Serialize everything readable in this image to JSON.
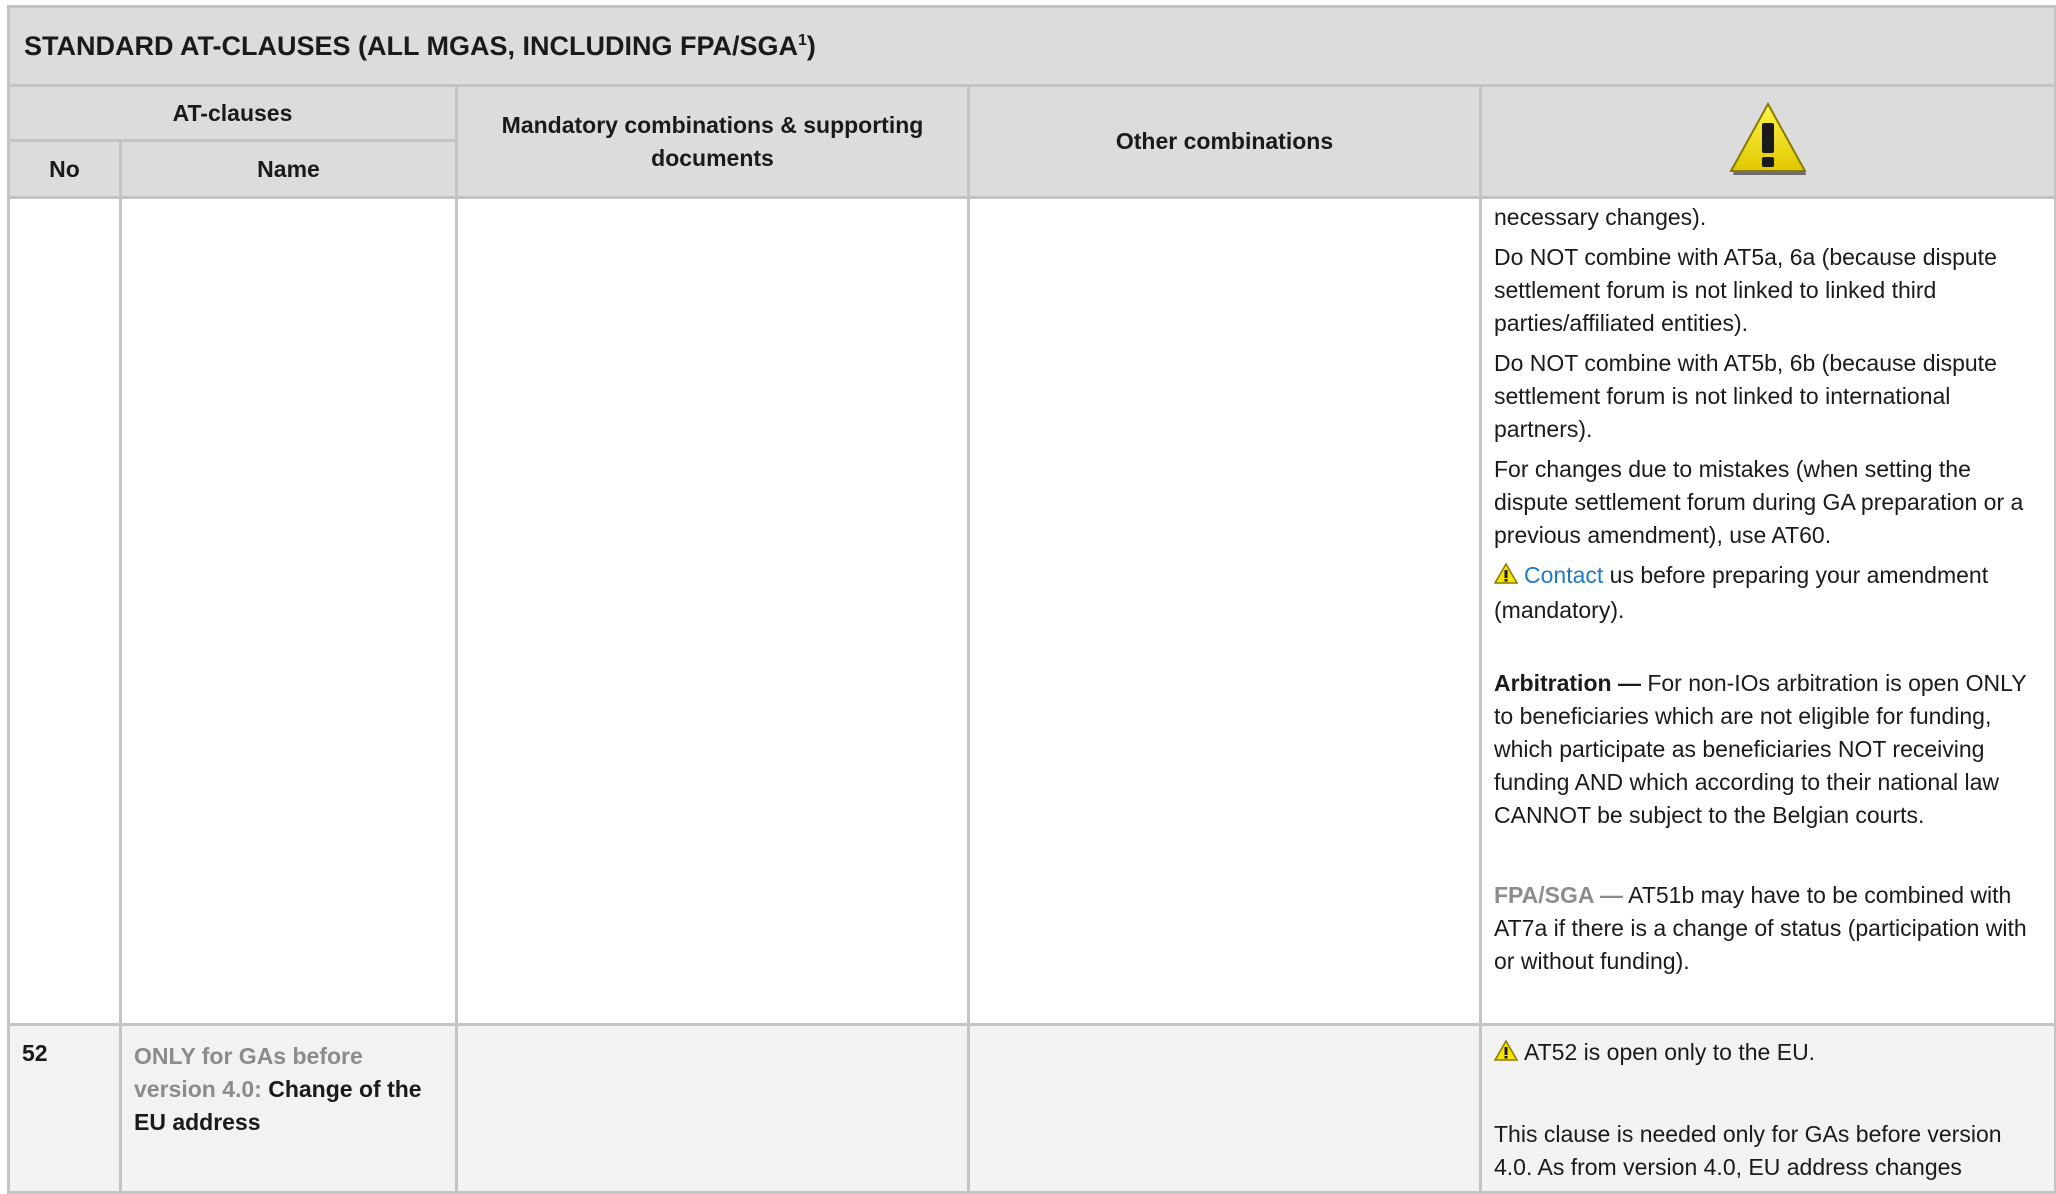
{
  "table": {
    "title": "STANDARD AT-CLAUSES (ALL MGAS, INCLUDING FPA/SGA",
    "title_sup": "1",
    "title_close": ")",
    "headers": {
      "at_clauses": "AT-clauses",
      "no": "No",
      "name": "Name",
      "mandatory": "Mandatory combinations & supporting documents",
      "other": "Other combinations"
    },
    "warning_icon": "warning-triangle-icon"
  },
  "row1": {
    "notes": {
      "p1": "necessary changes).",
      "p2": "Do NOT combine with AT5a, 6a (because dispute settlement forum is not linked to linked third parties/affiliated entities).",
      "p3": "Do NOT combine with AT5b, 6b (because dispute settlement forum is not linked to international partners).",
      "p4": "For changes due to mistakes (when setting the dispute settlement forum during GA preparation or a previous amendment), use AT60.",
      "p5_link": "Contact",
      "p5_rest": " us before preparing your amendment (mandatory).",
      "p6_bold": "Arbitration —",
      "p6_rest": " For non-IOs arbitration is open ONLY to beneficiaries which are not eligible for funding,  which participate as beneficiaries NOT receiving funding AND which according to their national law CANNOT be subject to the Belgian courts.",
      "p7_grey": "FPA/SGA —",
      "p7_rest": " AT51b may have to be combined with AT7a if there is a change of status (participation with or without funding)."
    }
  },
  "row2": {
    "no": "52",
    "name_grey": "ONLY for GAs before version 4.0:",
    "name_bold": " Change of the EU address",
    "notes": {
      "p1": "AT52 is open only to the EU.",
      "p2": "This clause is needed only for GAs before version 4.0. As from version 4.0, EU address changes"
    }
  },
  "colors": {
    "header_bg": "#dcdcdc",
    "border": "#c4c4c4",
    "link": "#1f7bc1",
    "grey_text": "#8c8c8c",
    "warning_yellow": "#f5e400"
  }
}
